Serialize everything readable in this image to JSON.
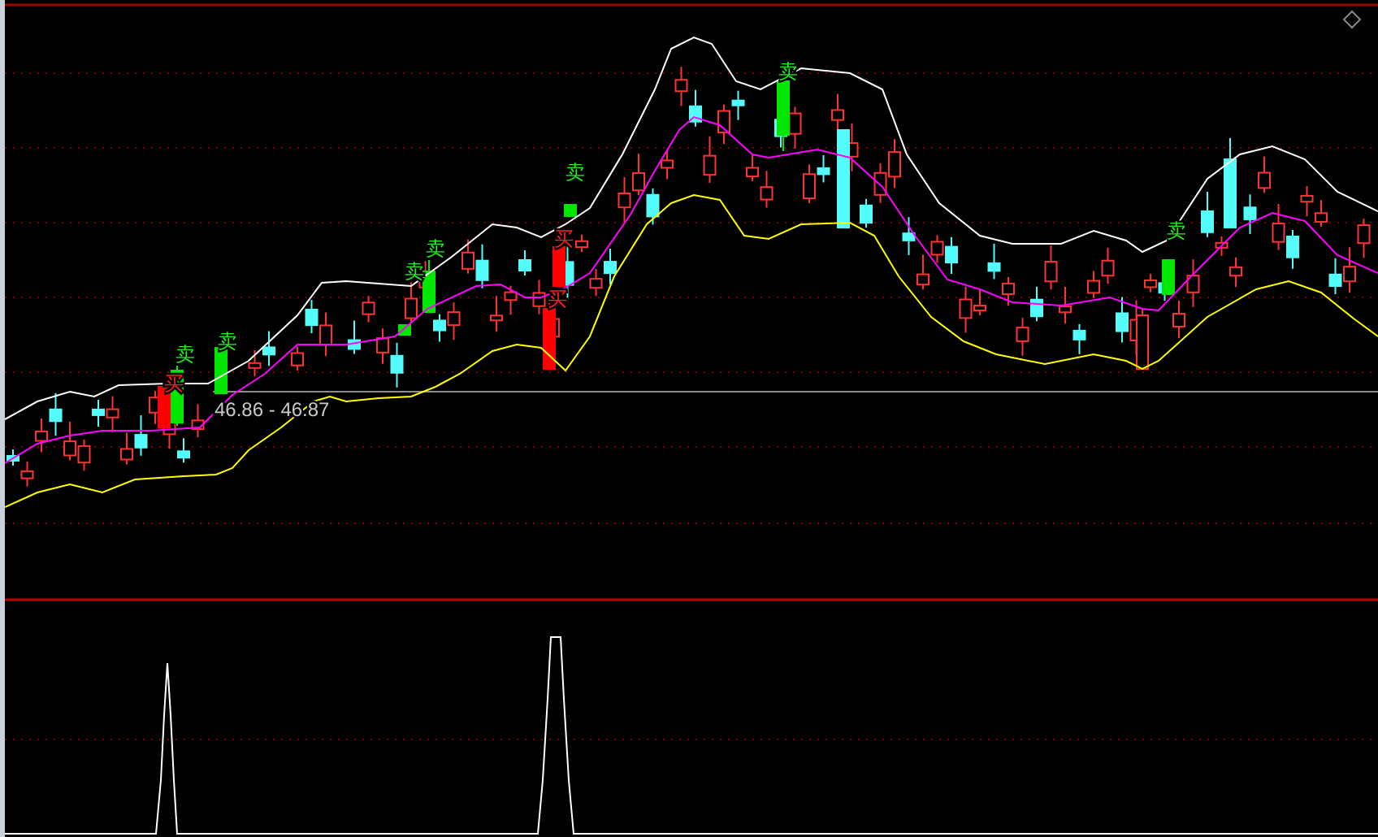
{
  "price_pane": {
    "price_range_label": "46.86 - 46.87",
    "signals": [
      {
        "kind": "buy",
        "text": "买"
      },
      {
        "kind": "sell",
        "text": "卖"
      },
      {
        "kind": "sell",
        "text": "卖"
      },
      {
        "kind": "sell",
        "text": "卖"
      },
      {
        "kind": "sell",
        "text": "卖"
      },
      {
        "kind": "buy",
        "text": "买"
      },
      {
        "kind": "buy",
        "text": "买"
      },
      {
        "kind": "sell",
        "text": "卖"
      },
      {
        "kind": "sell",
        "text": "卖"
      },
      {
        "kind": "sell",
        "text": "卖"
      }
    ]
  }
}
